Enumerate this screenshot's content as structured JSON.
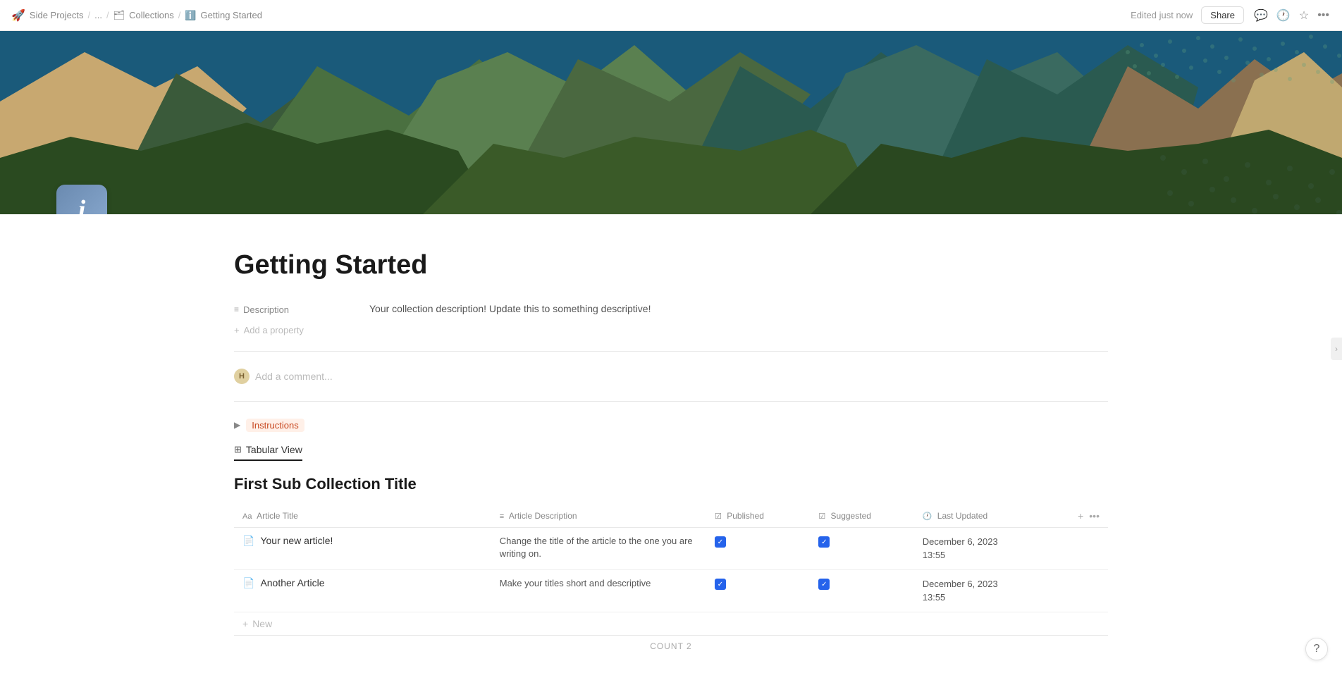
{
  "topbar": {
    "breadcrumb_rocket": "🚀",
    "breadcrumb_workspace": "Side Projects",
    "breadcrumb_sep1": "/",
    "breadcrumb_ellipsis": "...",
    "breadcrumb_sep2": "/",
    "breadcrumb_collections_icon": "🗂",
    "breadcrumb_collections": "Collections",
    "breadcrumb_sep3": "/",
    "breadcrumb_page_icon": "ℹ",
    "breadcrumb_current": "Getting Started",
    "edited_status": "Edited just now",
    "share_label": "Share"
  },
  "page": {
    "title": "Getting Started",
    "icon_letter": "i",
    "description_label": "Description",
    "description_value": "Your collection description! Update this to something descriptive!",
    "add_property_label": "Add a property",
    "add_comment_placeholder": "Add a comment...",
    "instructions_label": "Instructions",
    "tabular_view_label": "Tabular View"
  },
  "sub_collection": {
    "title": "First Sub Collection Title",
    "columns": {
      "article_title": "Article Title",
      "article_desc": "Article Description",
      "published": "Published",
      "suggested": "Suggested",
      "last_updated": "Last Updated"
    },
    "rows": [
      {
        "title": "Your new article!",
        "description": "Change the title of the article to the one you are writing on.",
        "published": true,
        "suggested": true,
        "last_updated": "December 6, 2023",
        "last_updated_time": "13:55"
      },
      {
        "title": "Another Article",
        "description": "Make your titles short and descriptive",
        "published": true,
        "suggested": true,
        "last_updated": "December 6, 2023",
        "last_updated_time": "13:55"
      }
    ],
    "new_label": "New",
    "count_label": "COUNT",
    "count_value": "2"
  },
  "help": {
    "label": "?"
  }
}
